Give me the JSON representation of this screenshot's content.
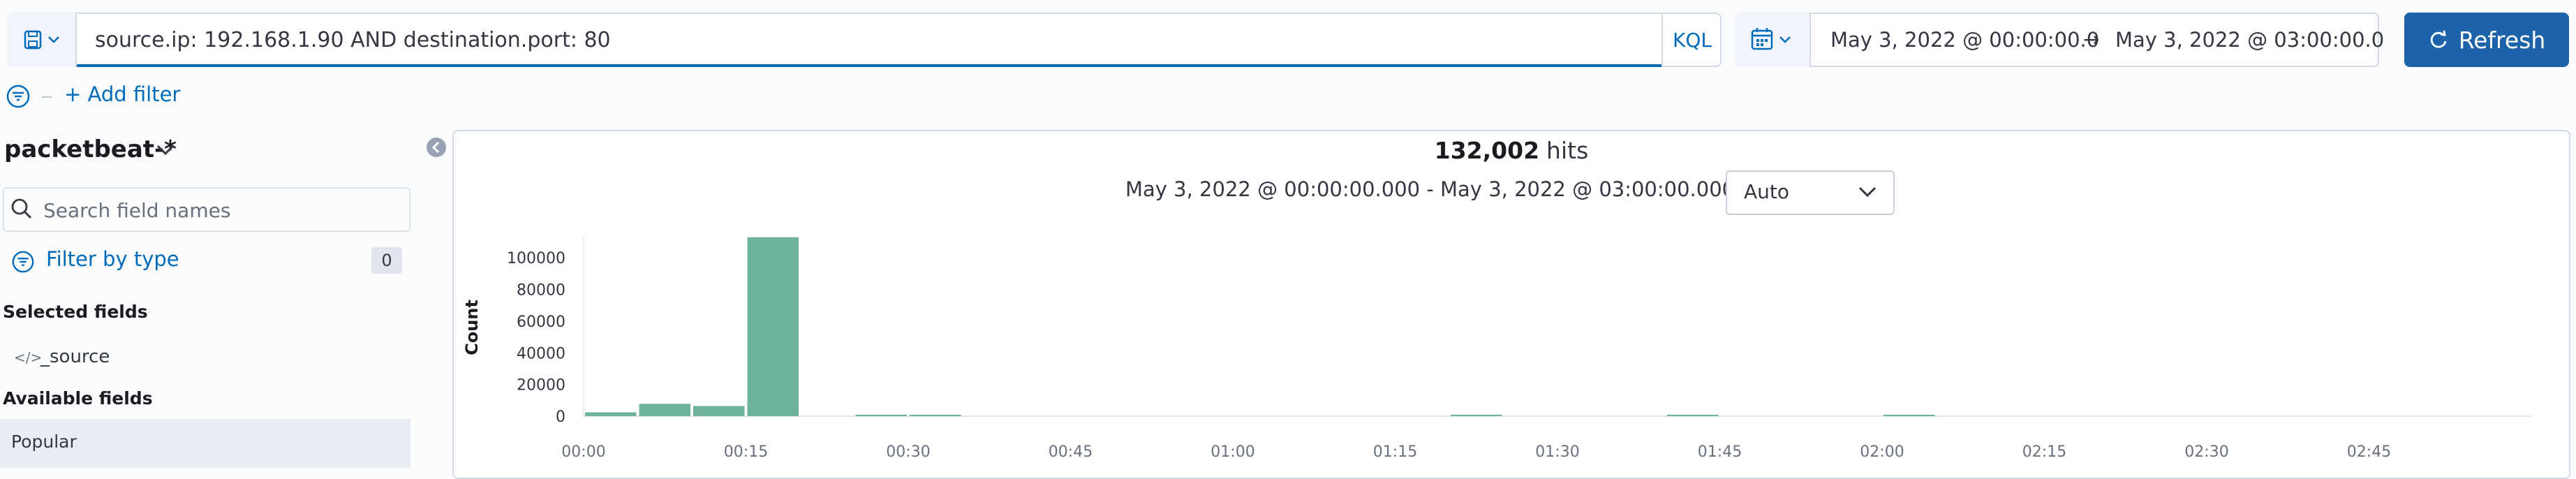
{
  "query_bar": {
    "query": "source.ip: 192.168.1.90 AND destination.port: 80",
    "language": "KQL"
  },
  "date_picker": {
    "start": "May 3, 2022 @ 00:00:00.0",
    "arrow": "→",
    "end": "May 3, 2022 @ 03:00:00.0"
  },
  "refresh": {
    "label": "Refresh"
  },
  "filters": {
    "add_filter": "+ Add filter"
  },
  "sidebar": {
    "index_pattern": "packetbeat-*",
    "search_placeholder": "Search field names",
    "filter_by_type": "Filter by type",
    "filter_count": "0",
    "selected_fields_heading": "Selected fields",
    "selected_fields": [
      {
        "name": "_source",
        "icon": "code-icon"
      }
    ],
    "available_fields_heading": "Available fields",
    "popular_label": "Popular"
  },
  "results": {
    "hits_count": "132,002",
    "hits_label": "hits",
    "time_range": "May 3, 2022 @ 00:00:00.000 - May 3, 2022 @ 03:00:00.000 —",
    "interval": "Auto"
  },
  "colors": {
    "accent": "#006bb8",
    "refresh_bg": "#1d63a9",
    "bar": "#6db39a"
  },
  "chart_data": {
    "type": "bar",
    "ylabel": "Count",
    "ylim": [
      0,
      112000
    ],
    "yticks": [
      0,
      20000,
      40000,
      60000,
      80000,
      100000
    ],
    "ytick_labels": [
      "0",
      "20000",
      "40000",
      "60000",
      "80000",
      "100000"
    ],
    "xlim": [
      0,
      180
    ],
    "xticks": [
      0,
      15,
      30,
      45,
      60,
      75,
      90,
      105,
      120,
      135,
      150,
      165
    ],
    "xtick_labels": [
      "00:00",
      "00:15",
      "00:30",
      "00:45",
      "01:00",
      "01:15",
      "01:30",
      "01:45",
      "02:00",
      "02:15",
      "02:30",
      "02:45"
    ],
    "bar_width_minutes": 5,
    "series": [
      {
        "x": [
          0,
          5,
          10,
          15,
          25,
          30,
          80,
          100,
          120
        ],
        "values": [
          2400,
          7800,
          6400,
          113000,
          250,
          300,
          200,
          150,
          180
        ]
      }
    ]
  }
}
